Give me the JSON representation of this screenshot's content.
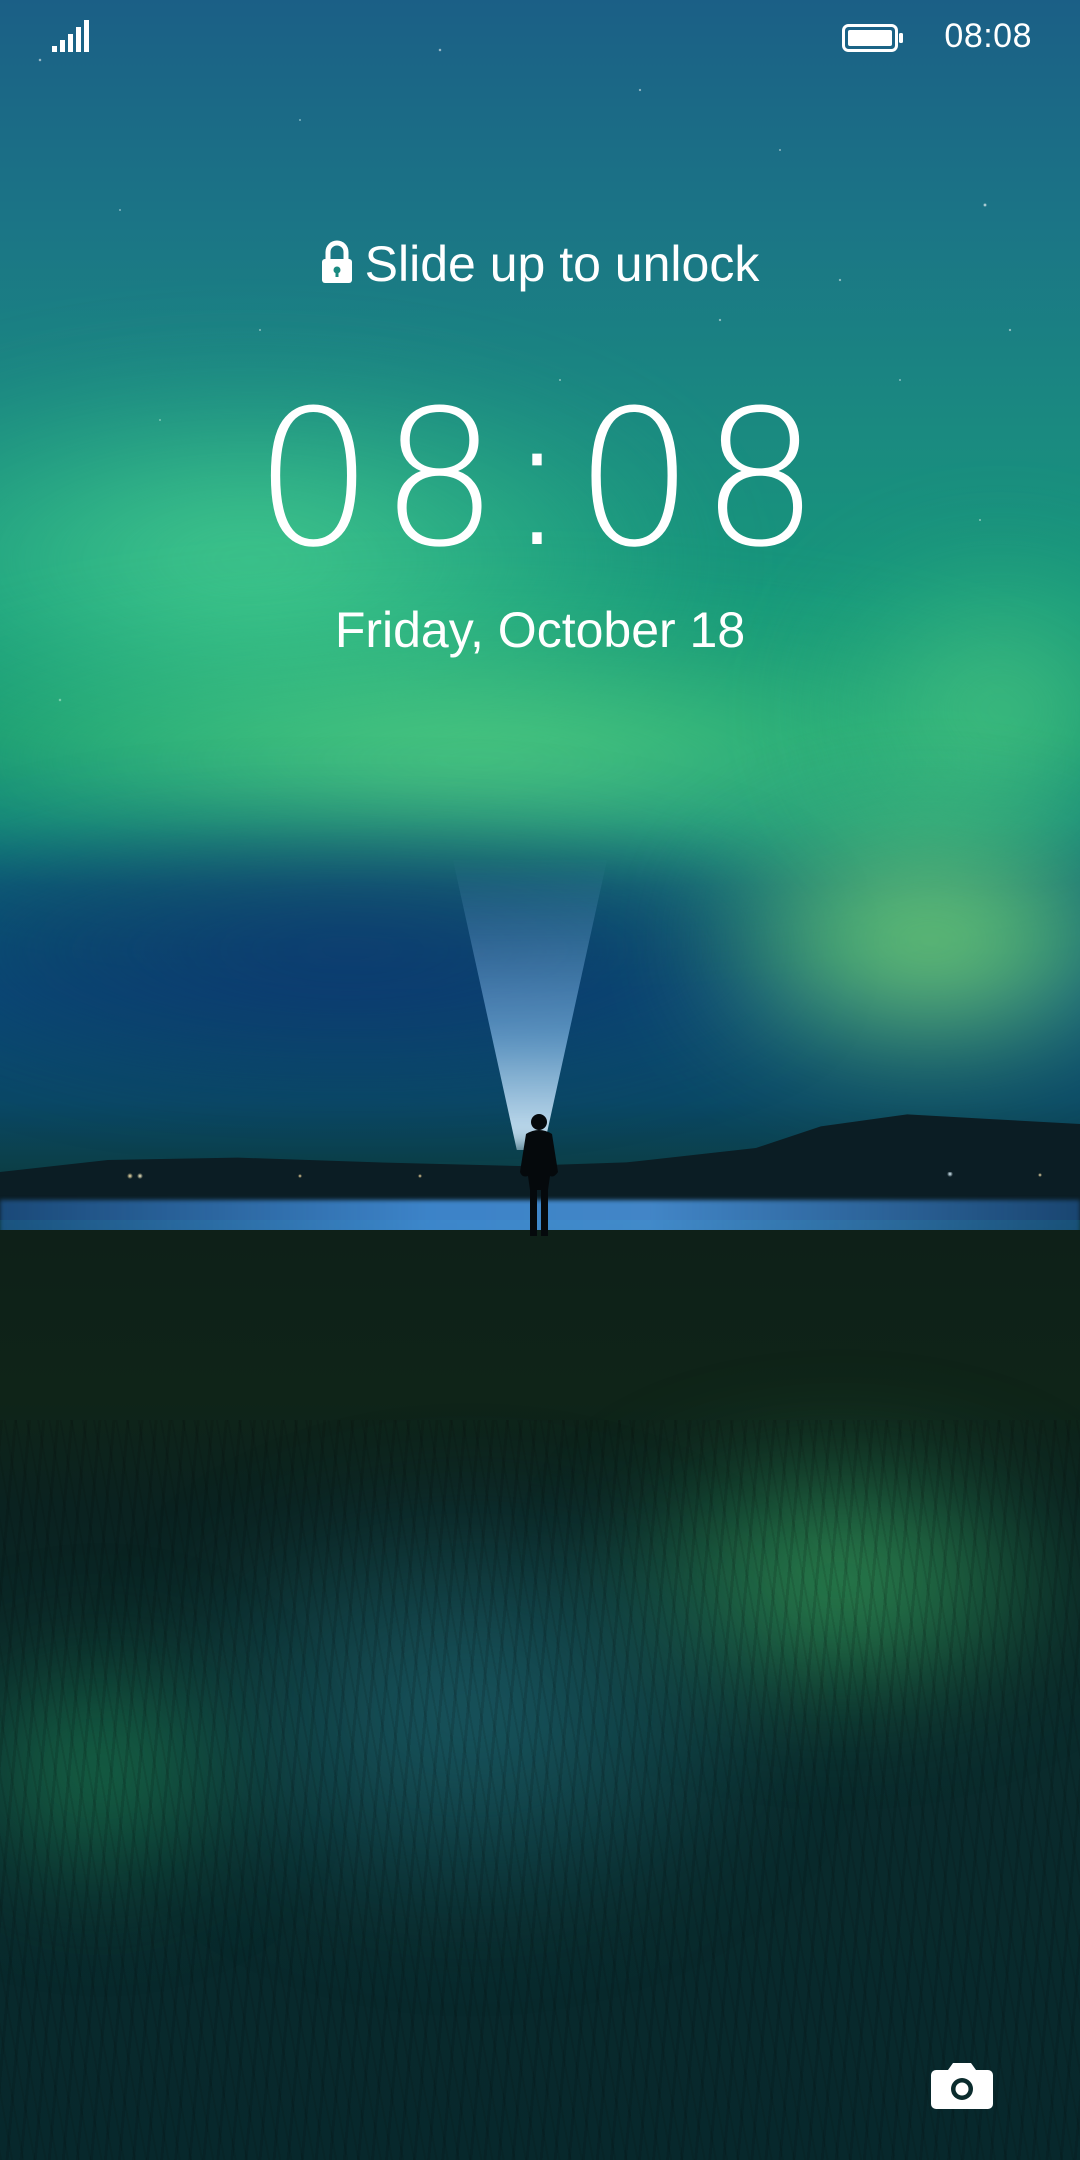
{
  "status_bar": {
    "time": "08:08",
    "signal_icon": "signal-bars-icon",
    "battery_icon": "battery-full-icon"
  },
  "lock_screen": {
    "unlock_hint": "Slide up to unlock",
    "lock_icon": "lock-icon",
    "clock": "08:08",
    "date": "Friday, October 18",
    "camera_shortcut_icon": "camera-icon"
  },
  "wallpaper": {
    "description_icon": "aurora-wallpaper",
    "colors": {
      "sky_top": "#1b5f86",
      "aurora_green": "#78eb8c",
      "ground": "#07282c"
    }
  }
}
